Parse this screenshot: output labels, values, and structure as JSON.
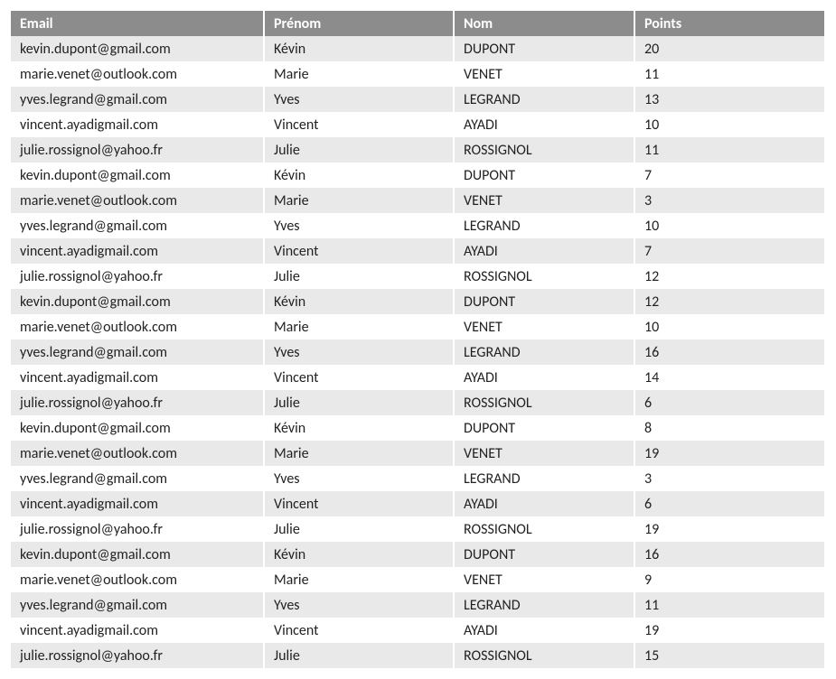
{
  "table": {
    "headers": {
      "email": "Email",
      "prenom": "Prénom",
      "nom": "Nom",
      "points": "Points"
    },
    "rows": [
      {
        "email": "kevin.dupont@gmail.com",
        "prenom": "Kévin",
        "nom": "DUPONT",
        "points": "20"
      },
      {
        "email": "marie.venet@outlook.com",
        "prenom": "Marie",
        "nom": "VENET",
        "points": "11"
      },
      {
        "email": "yves.legrand@gmail.com",
        "prenom": "Yves",
        "nom": "LEGRAND",
        "points": "13"
      },
      {
        "email": "vincent.ayadigmail.com",
        "prenom": "Vincent",
        "nom": "AYADI",
        "points": "10"
      },
      {
        "email": "julie.rossignol@yahoo.fr",
        "prenom": "Julie",
        "nom": "ROSSIGNOL",
        "points": "11"
      },
      {
        "email": "kevin.dupont@gmail.com",
        "prenom": "Kévin",
        "nom": "DUPONT",
        "points": "7"
      },
      {
        "email": "marie.venet@outlook.com",
        "prenom": "Marie",
        "nom": "VENET",
        "points": "3"
      },
      {
        "email": "yves.legrand@gmail.com",
        "prenom": "Yves",
        "nom": "LEGRAND",
        "points": "10"
      },
      {
        "email": "vincent.ayadigmail.com",
        "prenom": "Vincent",
        "nom": "AYADI",
        "points": "7"
      },
      {
        "email": "julie.rossignol@yahoo.fr",
        "prenom": "Julie",
        "nom": "ROSSIGNOL",
        "points": "12"
      },
      {
        "email": "kevin.dupont@gmail.com",
        "prenom": "Kévin",
        "nom": "DUPONT",
        "points": "12"
      },
      {
        "email": "marie.venet@outlook.com",
        "prenom": "Marie",
        "nom": "VENET",
        "points": "10"
      },
      {
        "email": "yves.legrand@gmail.com",
        "prenom": "Yves",
        "nom": "LEGRAND",
        "points": "16"
      },
      {
        "email": "vincent.ayadigmail.com",
        "prenom": "Vincent",
        "nom": "AYADI",
        "points": "14"
      },
      {
        "email": "julie.rossignol@yahoo.fr",
        "prenom": "Julie",
        "nom": "ROSSIGNOL",
        "points": "6"
      },
      {
        "email": "kevin.dupont@gmail.com",
        "prenom": "Kévin",
        "nom": "DUPONT",
        "points": "8"
      },
      {
        "email": "marie.venet@outlook.com",
        "prenom": "Marie",
        "nom": "VENET",
        "points": "19"
      },
      {
        "email": "yves.legrand@gmail.com",
        "prenom": "Yves",
        "nom": "LEGRAND",
        "points": "3"
      },
      {
        "email": "vincent.ayadigmail.com",
        "prenom": "Vincent",
        "nom": "AYADI",
        "points": "6"
      },
      {
        "email": "julie.rossignol@yahoo.fr",
        "prenom": "Julie",
        "nom": "ROSSIGNOL",
        "points": "19"
      },
      {
        "email": "kevin.dupont@gmail.com",
        "prenom": "Kévin",
        "nom": "DUPONT",
        "points": "16"
      },
      {
        "email": "marie.venet@outlook.com",
        "prenom": "Marie",
        "nom": "VENET",
        "points": "9"
      },
      {
        "email": "yves.legrand@gmail.com",
        "prenom": "Yves",
        "nom": "LEGRAND",
        "points": "11"
      },
      {
        "email": "vincent.ayadigmail.com",
        "prenom": "Vincent",
        "nom": "AYADI",
        "points": "19"
      },
      {
        "email": "julie.rossignol@yahoo.fr",
        "prenom": "Julie",
        "nom": "ROSSIGNOL",
        "points": "15"
      }
    ]
  }
}
